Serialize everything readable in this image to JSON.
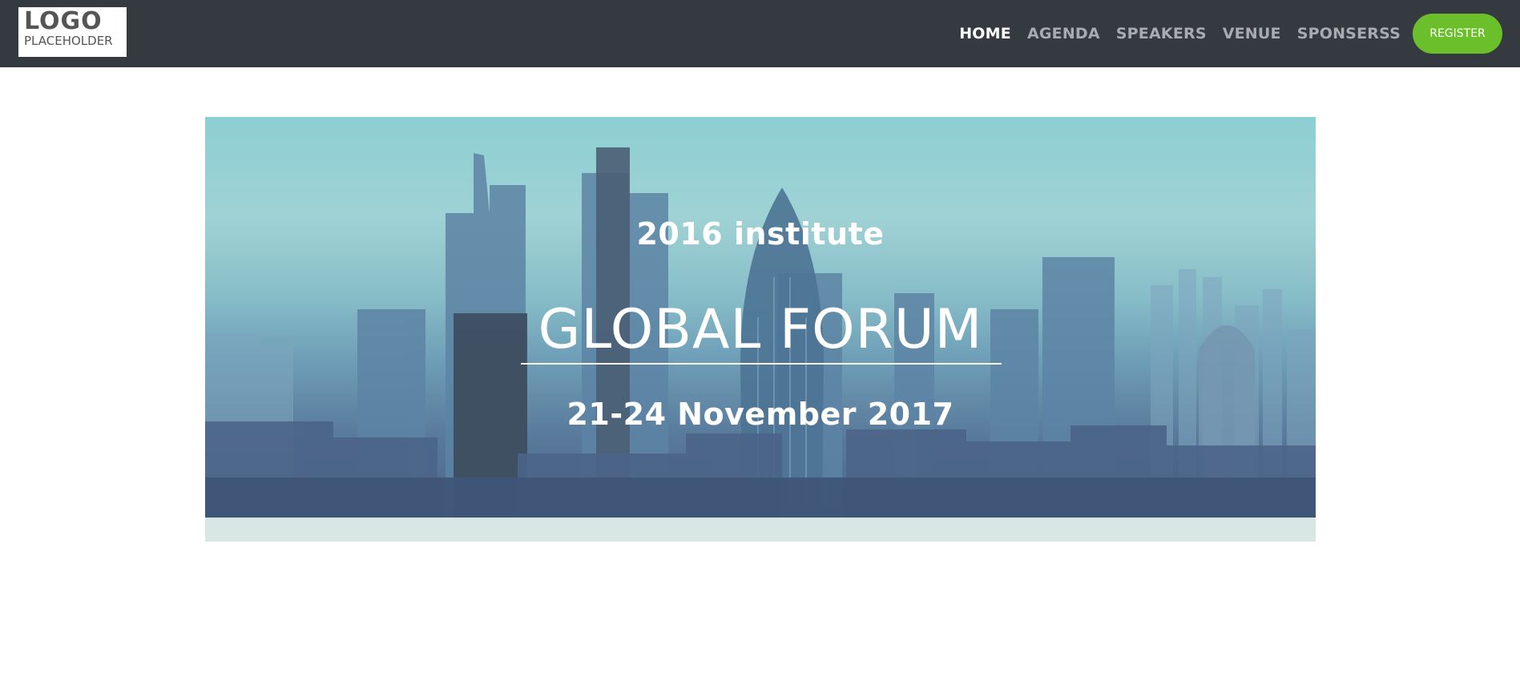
{
  "header": {
    "logo": {
      "line1": "LOGO",
      "line2": "PLACEHOLDER"
    },
    "nav": [
      {
        "label": "HOME",
        "active": true
      },
      {
        "label": "AGENDA",
        "active": false
      },
      {
        "label": "SPEAKERS",
        "active": false
      },
      {
        "label": "VENUE",
        "active": false
      },
      {
        "label": "SPONSERSS",
        "active": false
      }
    ],
    "register_label": "REGISTER"
  },
  "hero": {
    "subtitle": "2016 institute",
    "title": "GLOBAL FORUM",
    "dates": "21-24 November 2017"
  },
  "colors": {
    "navbar_bg": "#343a40",
    "nav_inactive": "#a9abae",
    "nav_active": "#ffffff",
    "register_bg": "#6abf2a",
    "hero_strip": "#d9e7e4"
  }
}
